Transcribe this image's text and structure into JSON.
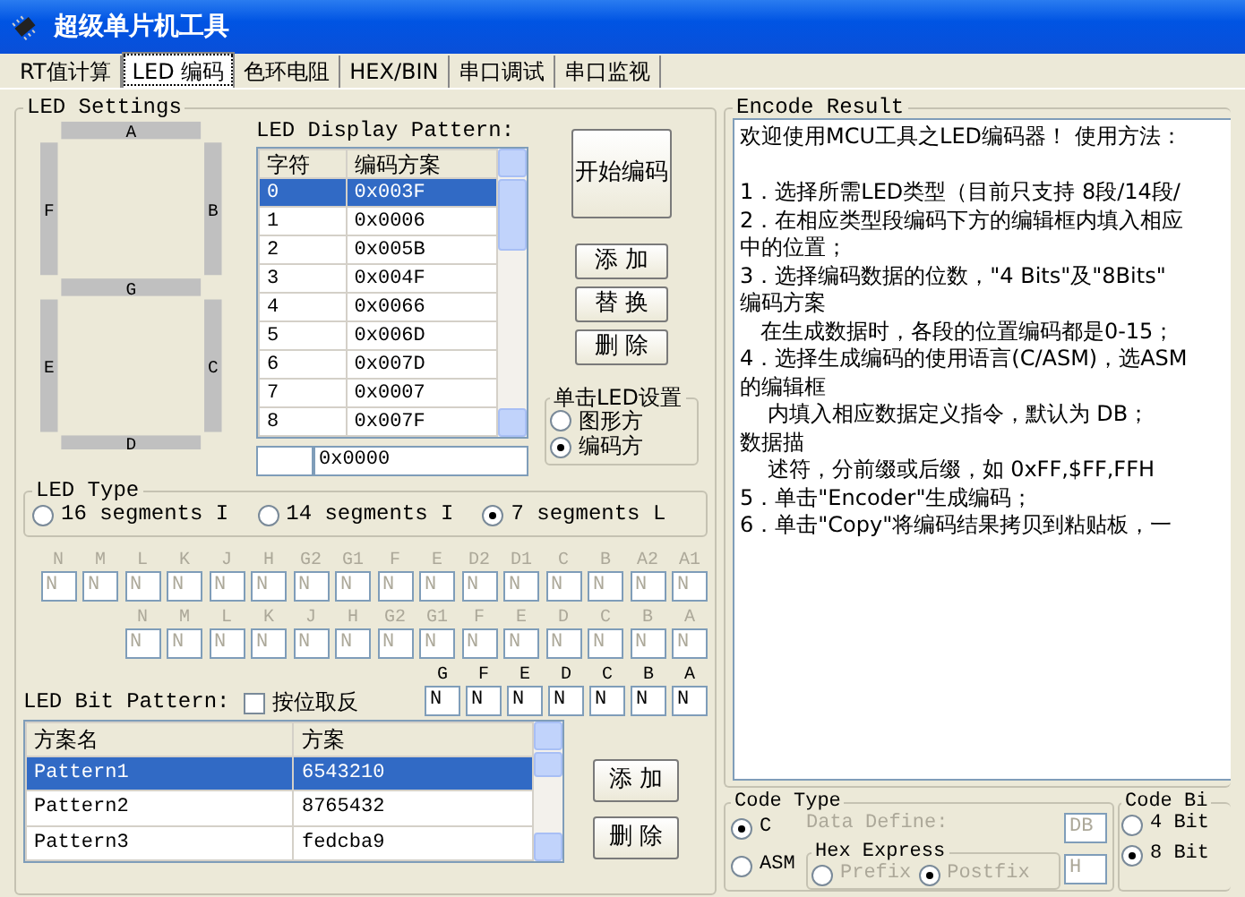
{
  "window": {
    "title": "超级单片机工具"
  },
  "tabs": [
    {
      "label": "RT值计算",
      "selected": false
    },
    {
      "label": "LED 编码",
      "selected": true
    },
    {
      "label": "色环电阻",
      "selected": false
    },
    {
      "label": "HEX/BIN",
      "selected": false
    },
    {
      "label": "串口调试",
      "selected": false
    },
    {
      "label": "串口监视",
      "selected": false
    }
  ],
  "led_settings": {
    "title": "LED Settings",
    "segments": [
      {
        "label": "A"
      },
      {
        "label": "B"
      },
      {
        "label": "C"
      },
      {
        "label": "D"
      },
      {
        "label": "E"
      },
      {
        "label": "F"
      },
      {
        "label": "G"
      }
    ],
    "display_pattern": {
      "label": "LED Display Pattern:",
      "columns": [
        "字符",
        "编码方案"
      ],
      "rows": [
        {
          "char": "0",
          "code": "0x003F",
          "selected": true
        },
        {
          "char": "1",
          "code": "0x0006",
          "selected": false
        },
        {
          "char": "2",
          "code": "0x005B",
          "selected": false
        },
        {
          "char": "3",
          "code": "0x004F",
          "selected": false
        },
        {
          "char": "4",
          "code": "0x0066",
          "selected": false
        },
        {
          "char": "5",
          "code": "0x006D",
          "selected": false
        },
        {
          "char": "6",
          "code": "0x007D",
          "selected": false
        },
        {
          "char": "7",
          "code": "0x0007",
          "selected": false
        },
        {
          "char": "8",
          "code": "0x007F",
          "selected": false
        }
      ],
      "input_code": "0x0000"
    },
    "buttons": [
      {
        "label": "开始编码",
        "kind": "large"
      },
      {
        "label": "添 加",
        "kind": "small"
      },
      {
        "label": "替 换",
        "kind": "small"
      },
      {
        "label": "删 除",
        "kind": "small"
      }
    ],
    "click_setting": {
      "title": "单击LED设置",
      "options": [
        {
          "label": "图形方",
          "selected": false
        },
        {
          "label": "编码方",
          "selected": true
        }
      ]
    },
    "led_type": {
      "title": "LED Type",
      "options": [
        {
          "label": "16 segments I",
          "selected": false
        },
        {
          "label": "14 segments I",
          "selected": false
        },
        {
          "label": "7 segments L",
          "selected": true
        }
      ]
    },
    "segment_rows": [
      {
        "disabled": true,
        "fields": [
          {
            "label": "N",
            "value": "N"
          },
          {
            "label": "M",
            "value": "N"
          },
          {
            "label": "L",
            "value": "N"
          },
          {
            "label": "K",
            "value": "N"
          },
          {
            "label": "J",
            "value": "N"
          },
          {
            "label": "H",
            "value": "N"
          },
          {
            "label": "G2",
            "value": "N"
          },
          {
            "label": "G1",
            "value": "N"
          },
          {
            "label": "F",
            "value": "N"
          },
          {
            "label": "E",
            "value": "N"
          },
          {
            "label": "D2",
            "value": "N"
          },
          {
            "label": "D1",
            "value": "N"
          },
          {
            "label": "C",
            "value": "N"
          },
          {
            "label": "B",
            "value": "N"
          },
          {
            "label": "A2",
            "value": "N"
          },
          {
            "label": "A1",
            "value": "N"
          }
        ]
      },
      {
        "disabled": true,
        "fields": [
          {
            "label": "N",
            "value": "N"
          },
          {
            "label": "M",
            "value": "N"
          },
          {
            "label": "L",
            "value": "N"
          },
          {
            "label": "K",
            "value": "N"
          },
          {
            "label": "J",
            "value": "N"
          },
          {
            "label": "H",
            "value": "N"
          },
          {
            "label": "G2",
            "value": "N"
          },
          {
            "label": "G1",
            "value": "N"
          },
          {
            "label": "F",
            "value": "N"
          },
          {
            "label": "E",
            "value": "N"
          },
          {
            "label": "D",
            "value": "N"
          },
          {
            "label": "C",
            "value": "N"
          },
          {
            "label": "B",
            "value": "N"
          },
          {
            "label": "A",
            "value": "N"
          }
        ]
      },
      {
        "disabled": false,
        "fields": [
          {
            "label": "G",
            "value": "N"
          },
          {
            "label": "F",
            "value": "N"
          },
          {
            "label": "E",
            "value": "N"
          },
          {
            "label": "D",
            "value": "N"
          },
          {
            "label": "C",
            "value": "N"
          },
          {
            "label": "B",
            "value": "N"
          },
          {
            "label": "A",
            "value": "N"
          }
        ]
      }
    ],
    "bit_pattern": {
      "label": "LED Bit Pattern:",
      "invert": {
        "label": "按位取反",
        "checked": false
      },
      "columns": [
        "方案名",
        "方案"
      ],
      "rows": [
        {
          "name": "Pattern1",
          "value": "6543210",
          "selected": true
        },
        {
          "name": "Pattern2",
          "value": "8765432",
          "selected": false
        },
        {
          "name": "Pattern3",
          "value": "fedcba9",
          "selected": false
        }
      ],
      "buttons": [
        "添 加",
        "删 除"
      ]
    }
  },
  "encode_result": {
    "title": "Encode Result",
    "paragraphs": [
      [
        "欢迎使用MCU工具之LED编码器！ 使用方法："
      ],
      [
        "1．选择所需LED类型（目前只支持 8段/14段/",
        "2．在相应类型段编码下方的编辑框内填入相应",
        "中的位置；",
        "3．选择编码数据的位数，\"4 Bits\"及\"8Bits\"",
        "编码方案",
        "   在生成数据时，各段的位置编码都是0-15；",
        "4．选择生成编码的使用语言(C/ASM)，选ASM",
        "的编辑框",
        "    内填入相应数据定义指令，默认为 DB；",
        "数据描",
        "    述符，分前缀或后缀，如 0xFF,$FF,FFH",
        "5．单击\"Encoder\"生成编码；",
        "6．单击\"Copy\"将编码结果拷贝到粘贴板，一"
      ]
    ]
  },
  "code_type": {
    "title": "Code Type",
    "options": [
      {
        "label": "C",
        "selected": true
      },
      {
        "label": "ASM",
        "selected": false
      }
    ],
    "data_define": {
      "label": "Data Define:",
      "value": "DB",
      "disabled": true
    },
    "hex_express": {
      "title": "Hex Express",
      "disabled": true,
      "options": [
        {
          "label": "Prefix",
          "selected": false
        },
        {
          "label": "Postfix",
          "selected": true
        }
      ]
    },
    "hex_value": "H"
  },
  "code_bit": {
    "title": "Code Bi",
    "options": [
      {
        "label": "4 Bit",
        "selected": false
      },
      {
        "label": "8 Bit",
        "selected": true
      }
    ]
  }
}
